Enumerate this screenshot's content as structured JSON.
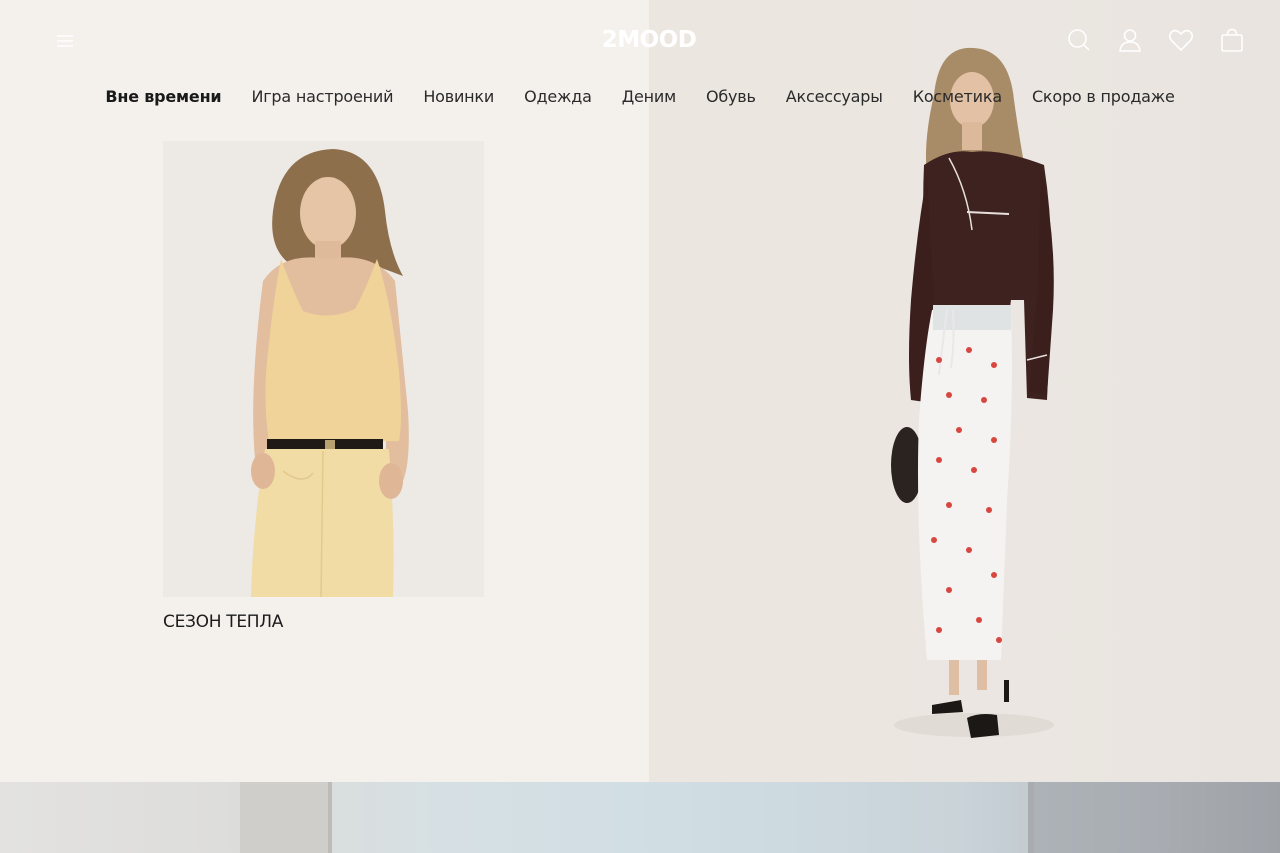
{
  "header": {
    "logo": "2MOOD",
    "icons": [
      "menu-icon",
      "search-icon",
      "account-icon",
      "heart-icon",
      "bag-icon"
    ]
  },
  "nav": {
    "items": [
      {
        "label": "Вне времени",
        "active": true
      },
      {
        "label": "Игра настроений",
        "active": false
      },
      {
        "label": "Новинки",
        "active": false
      },
      {
        "label": "Одежда",
        "active": false
      },
      {
        "label": "Деним",
        "active": false
      },
      {
        "label": "Обувь",
        "active": false
      },
      {
        "label": "Аксессуары",
        "active": false
      },
      {
        "label": "Косметика",
        "active": false
      },
      {
        "label": "Скоро в продаже",
        "active": false
      }
    ]
  },
  "promo": {
    "caption": "СЕЗОН ТЕПЛА"
  },
  "colors": {
    "background": "#f4f1ed",
    "text": "#1c1c1c",
    "logo": "#ffffff"
  }
}
